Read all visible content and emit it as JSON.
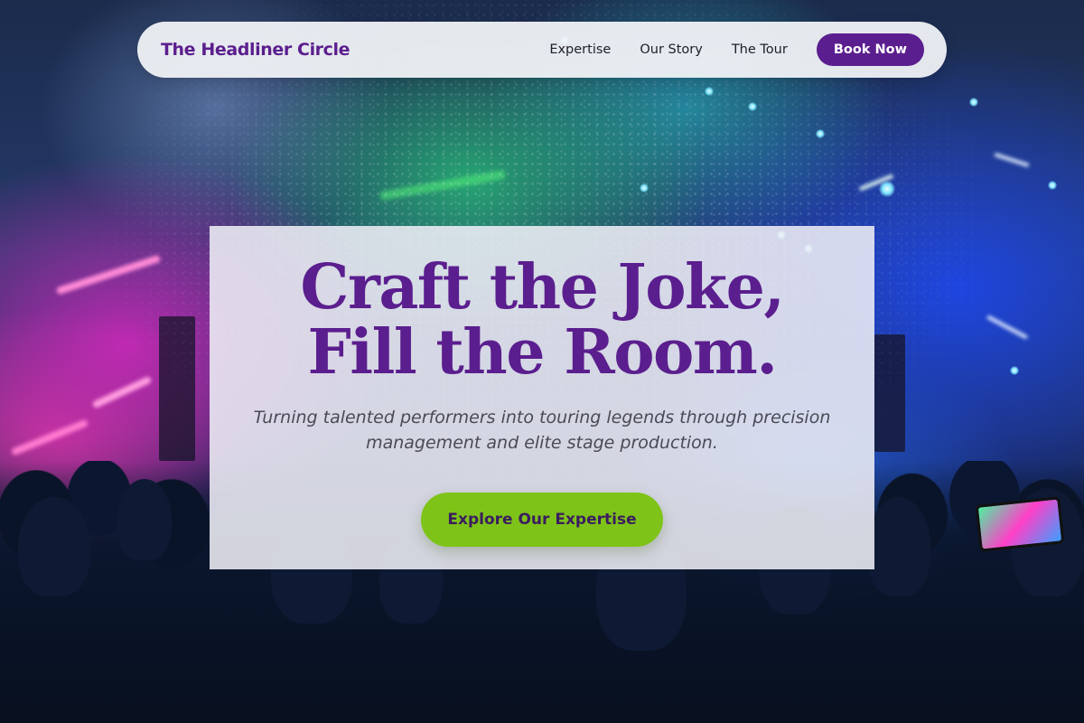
{
  "navbar": {
    "brand": "The Headliner Circle",
    "links": [
      {
        "label": "Expertise"
      },
      {
        "label": "Our Story"
      },
      {
        "label": "The Tour"
      }
    ],
    "cta_label": "Book Now"
  },
  "hero": {
    "headline_line1": "Craft the Joke,",
    "headline_line2": "Fill the Room.",
    "subtitle": "Turning talented performers into touring legends through precision management and elite stage production.",
    "cta_label": "Explore Our Expertise"
  },
  "colors": {
    "brand_purple": "#5b1e8e",
    "accent_green": "#7ec418",
    "navbar_bg": "#f1f3f7"
  }
}
